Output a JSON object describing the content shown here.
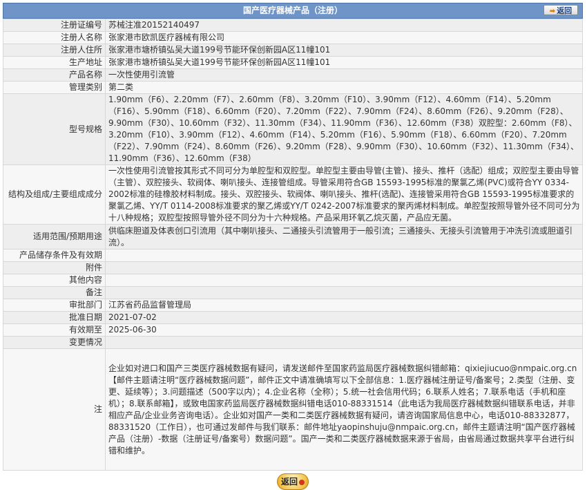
{
  "header": {
    "title": "国产医疗器械产品（注册）",
    "back_label": "返回"
  },
  "rows": [
    {
      "label": "注册证编号",
      "value": "苏械注准20152140497"
    },
    {
      "label": "注册人名称",
      "value": "张家港市欧凯医疗器械有限公司"
    },
    {
      "label": "注册人住所",
      "value": "张家港市塘桥镇弘吴大道199号节能环保创新园A区11幢101"
    },
    {
      "label": "生产地址",
      "value": "张家港市塘桥镇弘吴大道199号节能环保创新园A区11幢101"
    },
    {
      "label": "产品名称",
      "value": "一次性使用引流管"
    },
    {
      "label": "管理类别",
      "value": "第二类"
    },
    {
      "label": "型号规格",
      "value": "1.90mm（F6）、2.20mm（F7）、2.60mm（F8）、3.20mm（F10）、3.90mm（F12）、4.60mm（F14）、5.20mm（F16）、5.90mm（F18）、6.60mm（F20）、7.20mm（F22）、7.90mm（F24）、8.60mm（F26）、9.20mm（F28）、9.90mm（F30）、10.60mm（F32）、11.30mm（F34）、11.90mm（F36）、12.60mm（F38）双腔型：2.60mm（F8）、3.20mm（F10）、3.90mm（F12）、4.60mm（F14）、5.20mm（F16）、5.90mm（F18）、6.60mm（F20）、7.20mm（F22）、7.90mm（F24）、8.60mm（F26）、9.20mm（F28）、9.90mm（F30）、10.60mm（F32）、11.30mm（F34）、11.90mm（F36）、12.60mm（F38）"
    },
    {
      "label": "结构及组成/主要组成成分",
      "value": "一次性使用引流管按其形式不同可分为单腔型和双腔型。单腔型主要由导管(主管)、接头、推杆（选配）组成；双腔型主要由导管（主管）、双腔接头、软阀体、喇叭接头、连接管组成。导管采用符合GB 15593-1995标准的聚氯乙烯(PVC)或符合YY 0334-2002标准的硅橡胶材料制成。接头、双腔接头、软阀体、喇叭接头、推杆(选配)、连接管采用符合GB 15593-1995标准要求的聚氯乙烯、YY/T 0114-2008标准要求的聚乙烯或YY/T 0242-2007标准要求的聚丙烯材料制成。单腔型按照导管外径不同可分为十八种规格；双腔型按照导管外径不同分为十六种规格。产品采用环氧乙烷灭菌，产品应无菌。"
    },
    {
      "label": "适用范围/预期用途",
      "value": "供临床胆道及体表创口引流用（其中喇叭接头、二通接头引流管用于一般引流；三通接头、无接头引流管用于冲洗引流或胆道引流）。"
    },
    {
      "label": "产品储存条件及有效期",
      "value": ""
    },
    {
      "label": "附件",
      "value": ""
    },
    {
      "label": "其他内容",
      "value": ""
    },
    {
      "label": "备注",
      "value": ""
    },
    {
      "label": "审批部门",
      "value": "江苏省药品监督管理局"
    },
    {
      "label": "批准日期",
      "value": "2021-07-02"
    },
    {
      "label": "有效期至",
      "value": "2025-06-30"
    },
    {
      "label": "变更情况",
      "value": ""
    },
    {
      "label": "注",
      "value": "企业如对进口和国产三类医疗器械数据有疑问，请发送邮件至国家药监局医疗器械数据纠错邮箱：qixiejiucuo@nmpaic.org.cn【邮件主题请注明“医疗器械数据问题”，邮件正文中请准确填写以下全部信息：1.医疗器械注册证号/备案号；2.类型（注册、变更、延续等）；3.问题描述（500字以内）；4.企业名称（全称）；5.统一社会信用代码；6.联系人姓名；7.联系电话（手机和座机）；8.联系邮箱】，或致电国家药监局医疗器械数据纠错电话010-88331514（此电话为我局医疗器械数据纠错联系电话，并非相应产品/企业业务咨询电话）。企业如对国产一类和二类医疗器械数据有疑问，请咨询国家局信息中心，电话010-88332877，88331520（工作日），也可通过发邮件与我们联系：邮件地址yaopinshuju@nmpaic.org.cn，邮件主题请注明“国产医疗器械产品（注册）-数据（注册证号/备案号）数据问题”。国产一类和二类医疗器械数据来源于省局，由省局通过数据共享平台进行纠错和维护。"
    }
  ],
  "footer": {
    "back_label": "返回"
  }
}
